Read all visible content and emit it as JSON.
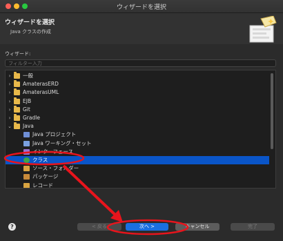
{
  "window": {
    "title": "ウィザードを選択"
  },
  "header": {
    "title": "ウィザードを選択",
    "description": "Java クラスの作成"
  },
  "wizards_label": "ウィザード:",
  "filter": {
    "placeholder": "フィルター入力",
    "value": ""
  },
  "tree": {
    "items": [
      {
        "label": "一般",
        "icon": "folder-icon",
        "expanded": false,
        "level": 0
      },
      {
        "label": "AmaterasERD",
        "icon": "folder-icon",
        "expanded": false,
        "level": 0
      },
      {
        "label": "AmaterasUML",
        "icon": "folder-icon",
        "expanded": false,
        "level": 0
      },
      {
        "label": "EJB",
        "icon": "folder-icon",
        "expanded": false,
        "level": 0
      },
      {
        "label": "Git",
        "icon": "folder-icon",
        "expanded": false,
        "level": 0
      },
      {
        "label": "Gradle",
        "icon": "folder-icon",
        "expanded": false,
        "level": 0
      },
      {
        "label": "Java",
        "icon": "folder-icon",
        "expanded": true,
        "level": 0
      },
      {
        "label": "Java プロジェクト",
        "icon": "java-project-icon",
        "level": 1
      },
      {
        "label": "Java ワーキング・セット",
        "icon": "working-set-icon",
        "level": 1
      },
      {
        "label": "インターフェース",
        "icon": "interface-icon",
        "level": 1
      },
      {
        "label": "クラス",
        "icon": "class-icon",
        "level": 1,
        "selected": true
      },
      {
        "label": "ソース・フォルダー",
        "icon": "source-folder-icon",
        "level": 1
      },
      {
        "label": "パッケージ",
        "icon": "package-icon",
        "level": 1
      },
      {
        "label": "レコード",
        "icon": "record-icon",
        "level": 1
      }
    ]
  },
  "buttons": {
    "help": "?",
    "back": "< 戻る",
    "next": "次へ >",
    "cancel": "キャンセル",
    "finish": "完了"
  },
  "colors": {
    "selection": "#0a55c8",
    "primary_button": "#1a6fe0",
    "annotation": "#e8141c"
  }
}
